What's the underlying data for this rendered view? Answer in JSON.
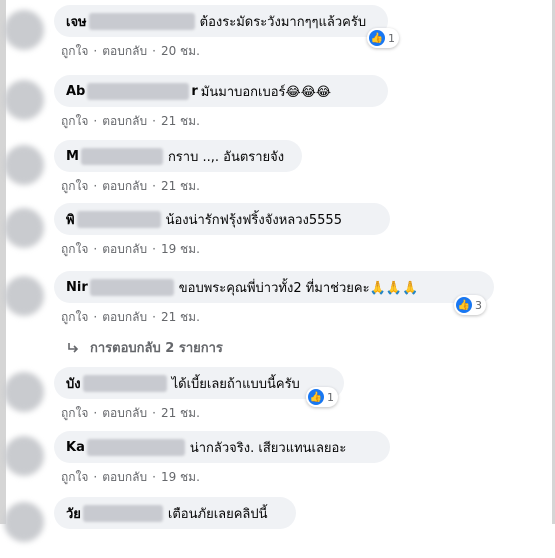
{
  "reply_label": "ตอบกลับ",
  "like_label": "ถูกใจ",
  "separator": "·",
  "view_replies": "การตอบกลับ 2 รายการ",
  "comments": [
    {
      "author_visible": "เจษ",
      "text": "ต้องระมัดระวังมากๆๆแล้วครับ",
      "time": "20 ชม.",
      "reaction_count": "1"
    },
    {
      "author_visible": "Ab",
      "author_tail": "r",
      "text": "มันมาบอกเบอร์😂😂😂",
      "time": "21 ชม."
    },
    {
      "author_visible": "M",
      "text": "กราบ ..,. อันตรายจัง",
      "time": "21 ชม."
    },
    {
      "author_visible": "พิ",
      "text": "น้องน่ารักฟรุ้งฟริ้งจังหลวง5555",
      "time": "19 ชม."
    },
    {
      "author_visible": "Nir",
      "text": "ขอบพระคุณพี่บ่าวทั้ง2 ที่มาช่วยคะ🙏🙏🙏",
      "time": "21 ชม.",
      "reaction_count": "3"
    },
    {
      "author_visible": "บัง",
      "text": "ได้เบี้ยเลยถ้าแบบนี้ครับ",
      "time": "21 ชม.",
      "reaction_count": "1"
    },
    {
      "author_visible": "Ka",
      "text": "น่ากลัวจริง. เสียวแทนเลยอะ",
      "time": "19 ชม."
    },
    {
      "author_visible": "วัย",
      "text": "เตือนภัยเลยคลิปนี้"
    }
  ],
  "colors": {
    "bubble": "#f0f2f5",
    "meta_text": "#65676b",
    "like_blue": "#1877f2"
  }
}
